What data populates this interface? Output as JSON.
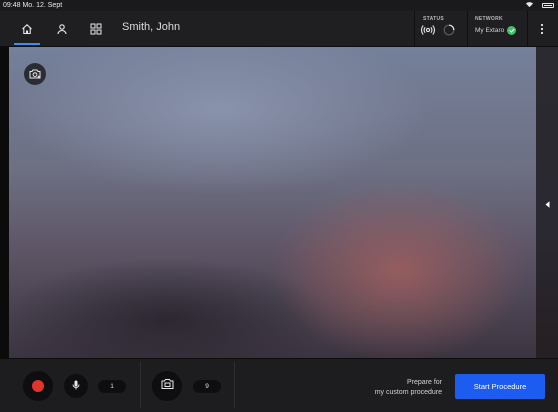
{
  "status_bar": {
    "time": "09:48  Mo. 12. Sept"
  },
  "header": {
    "patient_name": "Smith, John",
    "status_label": "STATUS",
    "network_label": "NETWORK",
    "network_name": "My Extaro"
  },
  "icons": {
    "home": "home-icon",
    "person": "person-icon",
    "grid": "grid-icon",
    "status_signal": "broadcast-icon",
    "status_loading": "spinner-icon",
    "network_connected": "check-circle-icon",
    "menu": "more-vertical-icon",
    "snapshot": "camera-snapshot-icon",
    "panel_toggle": "chevron-left-icon",
    "record": "record-icon",
    "microphone": "microphone-icon",
    "camera": "camera-icon"
  },
  "bottom_bar": {
    "mic_count": "1",
    "snapshot_count": "9",
    "prepare_line1": "Prepare for",
    "prepare_line2": "my custom procedure",
    "start_button": "Start Procedure"
  },
  "colors": {
    "accent": "#1d5cf0",
    "active_tab": "#3d8cf0",
    "record": "#e4322f",
    "connected": "#3ec26a"
  }
}
